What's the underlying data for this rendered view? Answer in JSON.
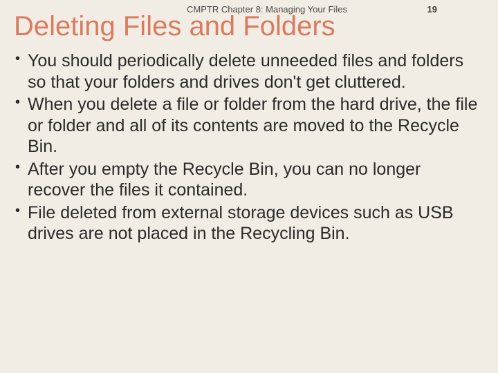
{
  "header": {
    "chapter_label": "CMPTR Chapter 8: Managing Your Files",
    "page_number": "19"
  },
  "title": "Deleting Files and Folders",
  "bullets": [
    "You should periodically delete unneeded files and folders so that your folders and drives don't get cluttered.",
    "When you delete a file or folder from the hard drive, the file or folder and all of its contents are moved to the Recycle Bin.",
    "After you empty the Recycle Bin, you can no longer recover the files it contained.",
    "File deleted from external storage devices such as USB drives are not placed in the Recycling Bin."
  ]
}
